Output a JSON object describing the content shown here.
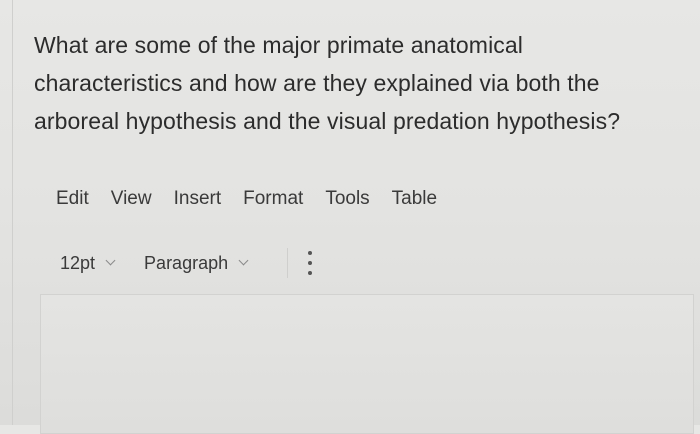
{
  "question": {
    "lines": [
      "What are some of the major primate anatomical",
      "characteristics and how are they explained via both the",
      "arboreal hypothesis and the visual predation hypothesis?"
    ]
  },
  "menubar": {
    "items": [
      "Edit",
      "View",
      "Insert",
      "Format",
      "Tools",
      "Table"
    ]
  },
  "toolbar": {
    "font_size": "12pt",
    "block_format": "Paragraph",
    "more_icon": "vertical-ellipsis-icon"
  },
  "editor": {
    "content": ""
  }
}
